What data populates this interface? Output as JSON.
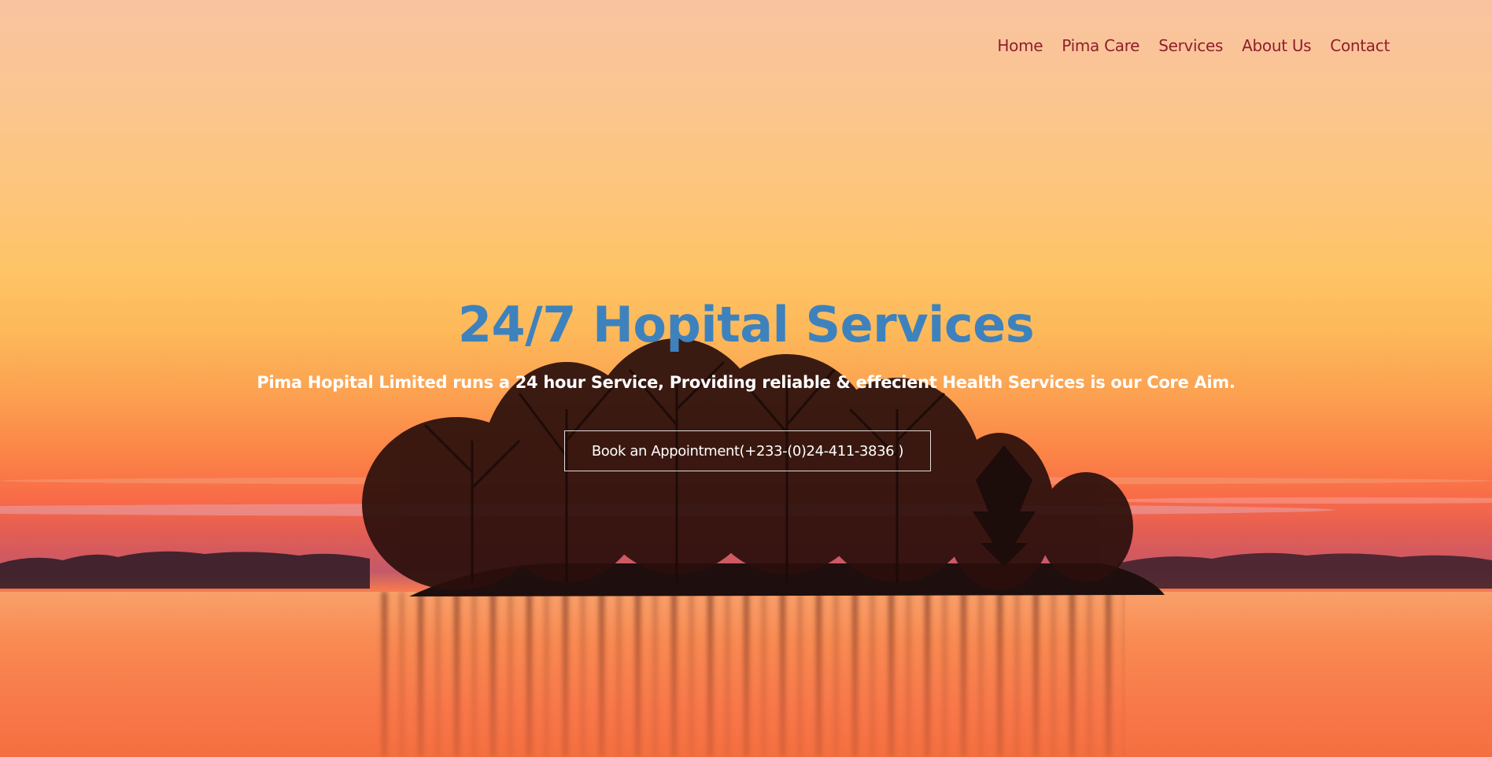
{
  "nav": {
    "items": [
      {
        "label": "Home"
      },
      {
        "label": "Pima Care"
      },
      {
        "label": "Services"
      },
      {
        "label": "About Us"
      },
      {
        "label": "Contact"
      }
    ]
  },
  "hero": {
    "title": "24/7 Hopital Services",
    "subtitle": "Pima Hopital Limited runs a 24 hour Service, Providing reliable & effecient Health Services is our Core Aim.",
    "cta_label": "Book an Appointment(+233-(0)24-411-3836 )"
  },
  "colors": {
    "nav_link": "#8e1f2b",
    "title": "#3e82bd",
    "subtitle": "#ffffff",
    "cta_border": "#ffffff"
  },
  "background": {
    "description_icon": "sunset-lake-trees-photo"
  }
}
